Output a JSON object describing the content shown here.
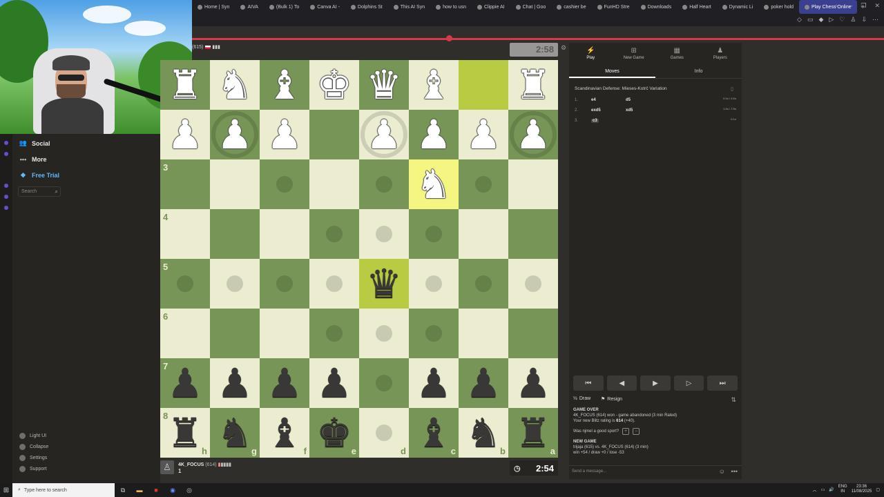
{
  "browser": {
    "tabs": [
      {
        "label": "Home | Syn",
        "active": false
      },
      {
        "label": "AIVA",
        "active": false
      },
      {
        "label": "(Bulk 1) To",
        "active": false
      },
      {
        "label": "Canva AI -",
        "active": false
      },
      {
        "label": "Dolphins St",
        "active": false
      },
      {
        "label": "This AI Syn",
        "active": false
      },
      {
        "label": "how to usn",
        "active": false
      },
      {
        "label": "Clippie AI",
        "active": false
      },
      {
        "label": "Chat | Goo",
        "active": false
      },
      {
        "label": "cashier be",
        "active": false
      },
      {
        "label": "FunHD Stre",
        "active": false
      },
      {
        "label": "Downloads",
        "active": false
      },
      {
        "label": "Half Heart",
        "active": false
      },
      {
        "label": "Dynamic Li",
        "active": false
      },
      {
        "label": "poker hold",
        "active": false
      },
      {
        "label": "Play Chess Online",
        "active": true
      }
    ],
    "new_tab": "+"
  },
  "sidebar": {
    "items": [
      {
        "label": "Social",
        "icon": "social-icon"
      },
      {
        "label": "More",
        "icon": "more-dots-icon"
      },
      {
        "label": "Free Trial",
        "icon": "diamond-icon"
      }
    ],
    "search_placeholder": "Search",
    "bottom": [
      {
        "label": "Light UI",
        "icon": "sun-icon"
      },
      {
        "label": "Collapse",
        "icon": "collapse-icon"
      },
      {
        "label": "Settings",
        "icon": "gear-icon"
      },
      {
        "label": "Support",
        "icon": "help-icon"
      }
    ]
  },
  "opponent": {
    "name_display": "(615)",
    "clock": "2:58"
  },
  "player": {
    "name": "4K_FOCUS",
    "rating": "(614)",
    "captured_count": "1",
    "clock": "2:54"
  },
  "board": {
    "orientation": "black-bottom",
    "rank_labels": [
      "3",
      "4",
      "5",
      "6",
      "7",
      "8"
    ],
    "file_labels": [
      "h",
      "g",
      "f",
      "e",
      "d",
      "c",
      "b",
      "a"
    ],
    "rows": [
      [
        "wR",
        "wN",
        "wB",
        "wK",
        "wQ",
        "wB",
        "",
        "wR"
      ],
      [
        "wP",
        "wP",
        "wP",
        "",
        "wP",
        "wP",
        "wP",
        "wP"
      ],
      [
        "",
        "",
        "",
        "",
        "",
        "wN",
        "",
        ""
      ],
      [
        "",
        "",
        "",
        "",
        "",
        "",
        "",
        ""
      ],
      [
        "",
        "",
        "",
        "",
        "bQ",
        "",
        "",
        ""
      ],
      [
        "",
        "",
        "",
        "",
        "",
        "",
        "",
        ""
      ],
      [
        "bP",
        "bP",
        "bP",
        "bP",
        "",
        "bP",
        "bP",
        "bP"
      ],
      [
        "bR",
        "bN",
        "bB",
        "bK",
        "",
        "bB",
        "bN",
        "bR"
      ]
    ],
    "highlights": [
      "0-6",
      "2-5",
      "4-4"
    ],
    "move_hints": [
      "2-2",
      "2-4",
      "2-6",
      "3-3",
      "3-4",
      "3-5",
      "4-0",
      "4-1",
      "4-2",
      "4-3",
      "4-5",
      "4-6",
      "4-7",
      "5-3",
      "5-4",
      "5-5",
      "6-4",
      "7-4"
    ],
    "capture_rings": [
      "1-1",
      "1-4",
      "1-7"
    ]
  },
  "panel": {
    "tabs": [
      {
        "label": "Play",
        "icon": "lightning-icon",
        "active": true
      },
      {
        "label": "New Game",
        "icon": "plus-board-icon",
        "active": false
      },
      {
        "label": "Games",
        "icon": "games-grid-icon",
        "active": false
      },
      {
        "label": "Players",
        "icon": "players-icon",
        "active": false
      }
    ],
    "subtabs": [
      {
        "label": "Moves",
        "active": true
      },
      {
        "label": "Info",
        "active": false
      }
    ],
    "opening": "Scandinavian Defense: Mieses-Kotrč Variation",
    "moves": [
      {
        "n": "1.",
        "w": "e4",
        "b": "d5",
        "t": "0.1s / 2.6s"
      },
      {
        "n": "2.",
        "w": "exd5",
        "b": "xd5",
        "t": "1.3s / 7.5s"
      },
      {
        "n": "3.",
        "w": "c3",
        "b": "",
        "t": "0.1s"
      }
    ],
    "nav": [
      "⏮",
      "◀",
      "▶",
      "▶",
      "⏭"
    ],
    "draw_label": "Draw",
    "resign_label": "Resign",
    "chat": {
      "game_over_header": "GAME OVER",
      "game_over_line": "4K_FOCUS (614) won - game abandoned (3 min Rated)",
      "rating_prefix": "Your new Blitz rating is ",
      "rating_value": "614",
      "rating_delta": " (+40).",
      "sport_question": "Was njmel a good sport?",
      "new_game_header": "NEW GAME",
      "new_game_line": "trijaja (615) vs. 4K_FOCUS (614) (3 min)",
      "odds_line": "win +54 / draw +0 / lose -53"
    },
    "message_placeholder": "Send a message..."
  },
  "taskbar": {
    "search_placeholder": "Type here to search",
    "lang": "ENG",
    "region": "IN",
    "time": "23:36",
    "date": "11/08/2025"
  }
}
